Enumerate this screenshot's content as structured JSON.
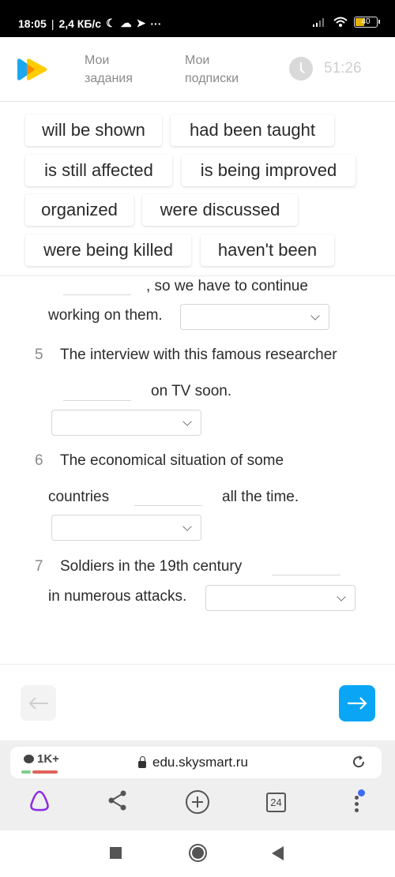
{
  "status_bar": {
    "time": "18:05",
    "network_speed": "2,4 КБ/с",
    "icons": [
      "moon-icon",
      "cloud-icon",
      "telegram-icon",
      "more-icon"
    ],
    "right_icons": [
      "signal-icon",
      "wifi-icon",
      "battery-icon"
    ],
    "battery_level": "40"
  },
  "header": {
    "logo": "skysmart-logo",
    "nav": [
      {
        "line1": "Мои",
        "line2": "задания"
      },
      {
        "line1": "Мои",
        "line2": "подписки"
      }
    ],
    "timer": "51:26"
  },
  "word_bank": [
    "will be shown",
    "had been taught",
    "is still affected",
    "is being improved",
    "organized",
    "were discussed",
    "were being killed",
    "haven't been"
  ],
  "exercise": {
    "q4": {
      "text_after_blank": ", so we have to continue",
      "text_line2": "working on them.",
      "selected": ""
    },
    "q5": {
      "number": "5",
      "text": "The interview with this famous researcher",
      "text_after_blank": "on TV soon.",
      "selected": ""
    },
    "q6": {
      "number": "6",
      "text": "The economical situation of some",
      "text_before_blank": "countries",
      "text_after_blank": "all the time.",
      "selected": ""
    },
    "q7": {
      "number": "7",
      "text": "Soldiers in the 19th century",
      "text_line2": "in numerous attacks.",
      "selected": ""
    }
  },
  "navigation": {
    "prev_icon": "arrow-left-icon",
    "next_icon": "arrow-right-icon",
    "accent_color": "#0aa6f5"
  },
  "browser": {
    "comments_count": "1K+",
    "url": "edu.skysmart.ru",
    "tabs_count": "24"
  }
}
